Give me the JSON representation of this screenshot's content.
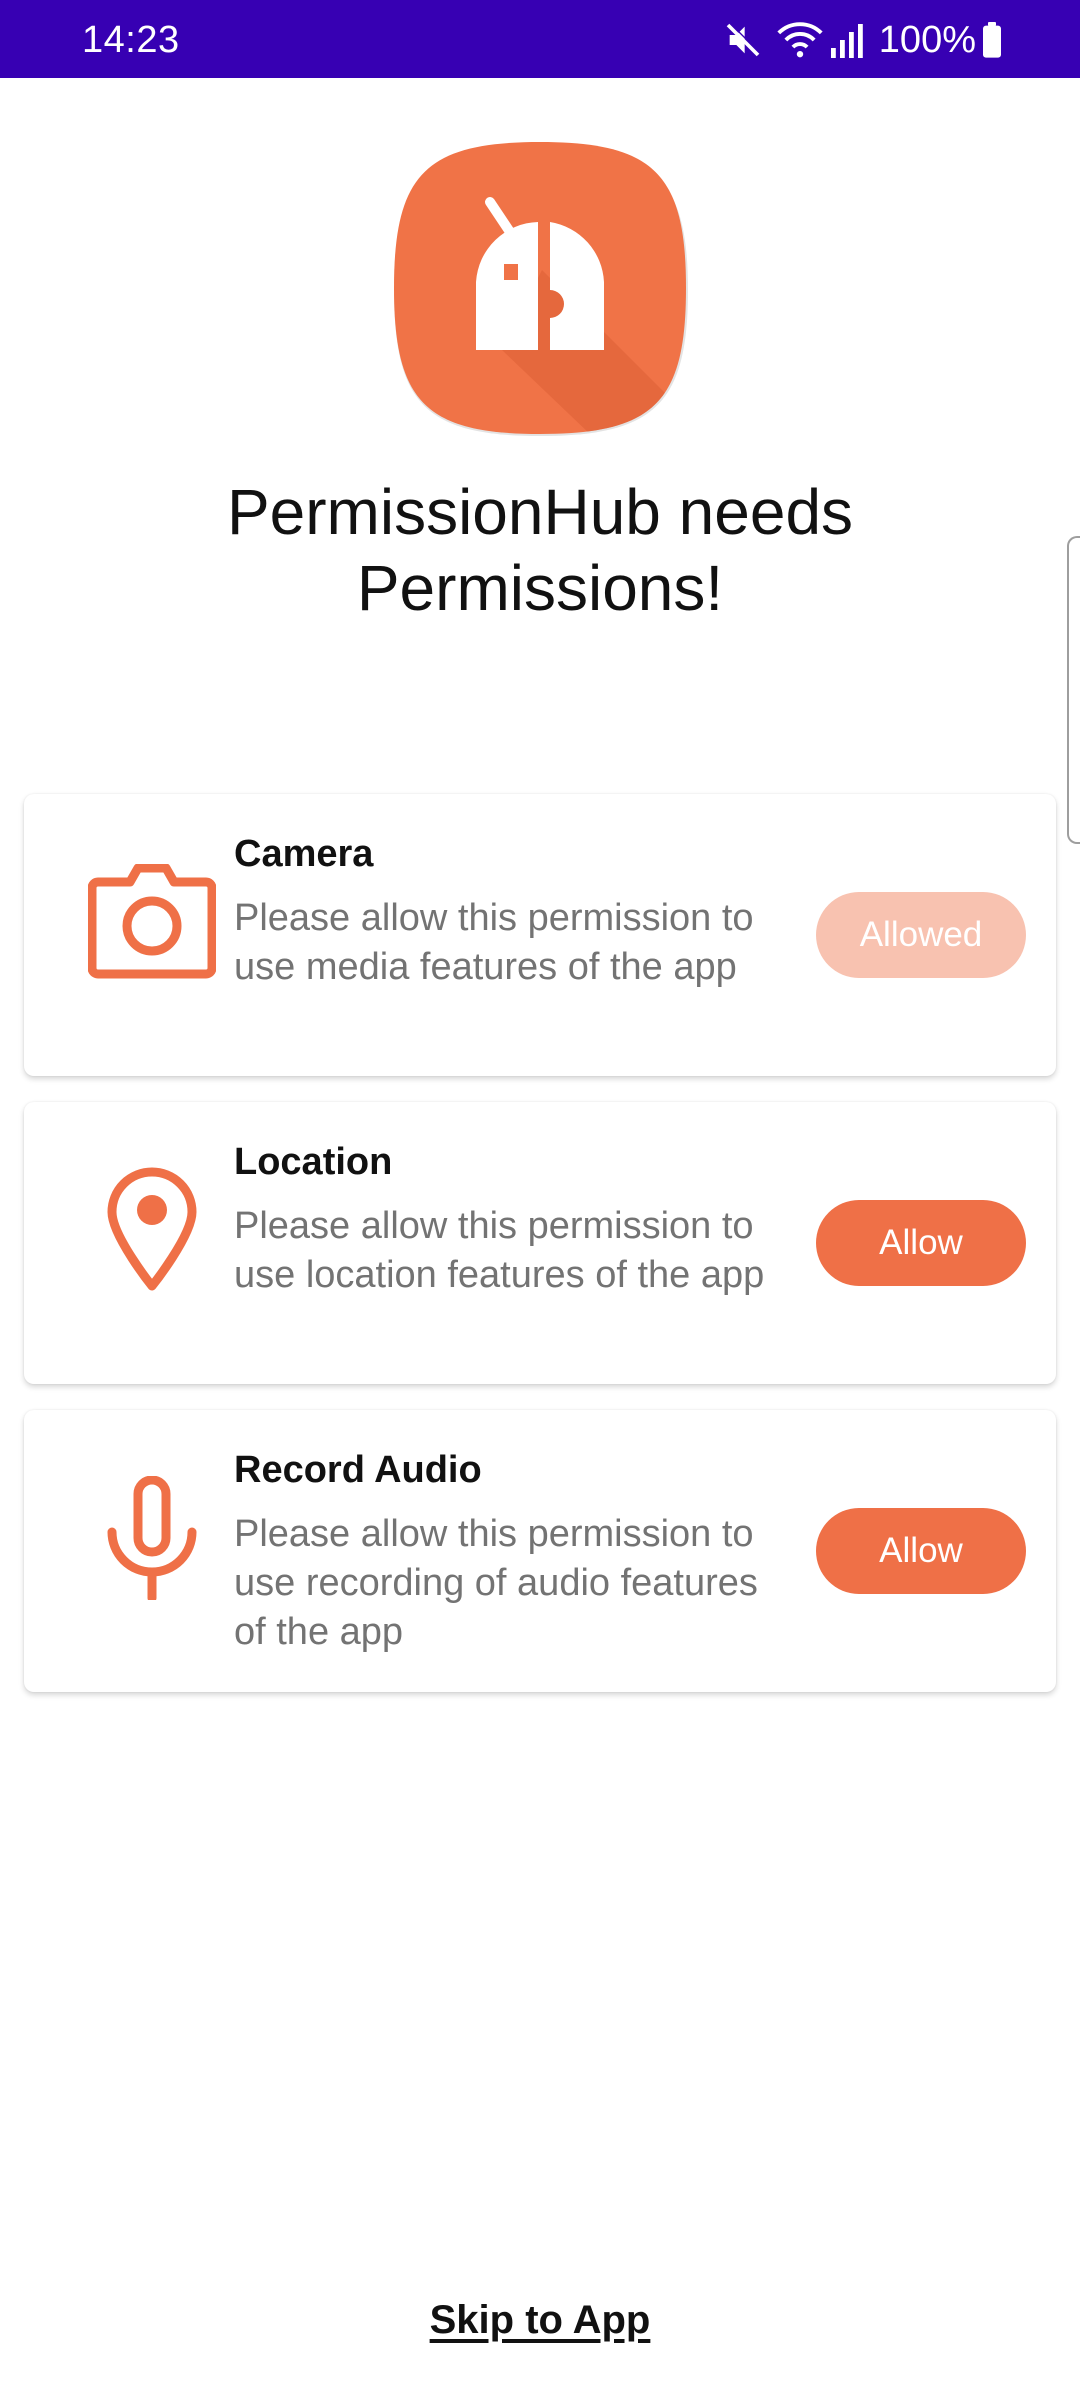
{
  "status_bar": {
    "time": "14:23",
    "battery": "100%",
    "icons": [
      "mute-icon",
      "wifi-icon",
      "signal-icon",
      "battery-icon"
    ],
    "background": "#3700b3"
  },
  "header": {
    "app_icon": "permissionhub-logo-icon",
    "title": "PermissionHub needs Permissions!"
  },
  "permissions": [
    {
      "icon": "camera-icon",
      "title": "Camera",
      "description": "Please allow this permission to use media features of the app",
      "button_label": "Allowed",
      "state": "allowed"
    },
    {
      "icon": "location-pin-icon",
      "title": "Location",
      "description": "Please allow this permission to use location features of the app",
      "button_label": "Allow",
      "state": "pending"
    },
    {
      "icon": "microphone-icon",
      "title": "Record Audio",
      "description": "Please allow this permission to use recording of audio features of the app",
      "button_label": "Allow",
      "state": "pending"
    }
  ],
  "footer": {
    "skip_label": "Skip to App"
  },
  "colors": {
    "accent": "#ef7047",
    "accent_disabled": "#f8c2b0",
    "title_text": "#111111",
    "body_text": "#737373"
  }
}
